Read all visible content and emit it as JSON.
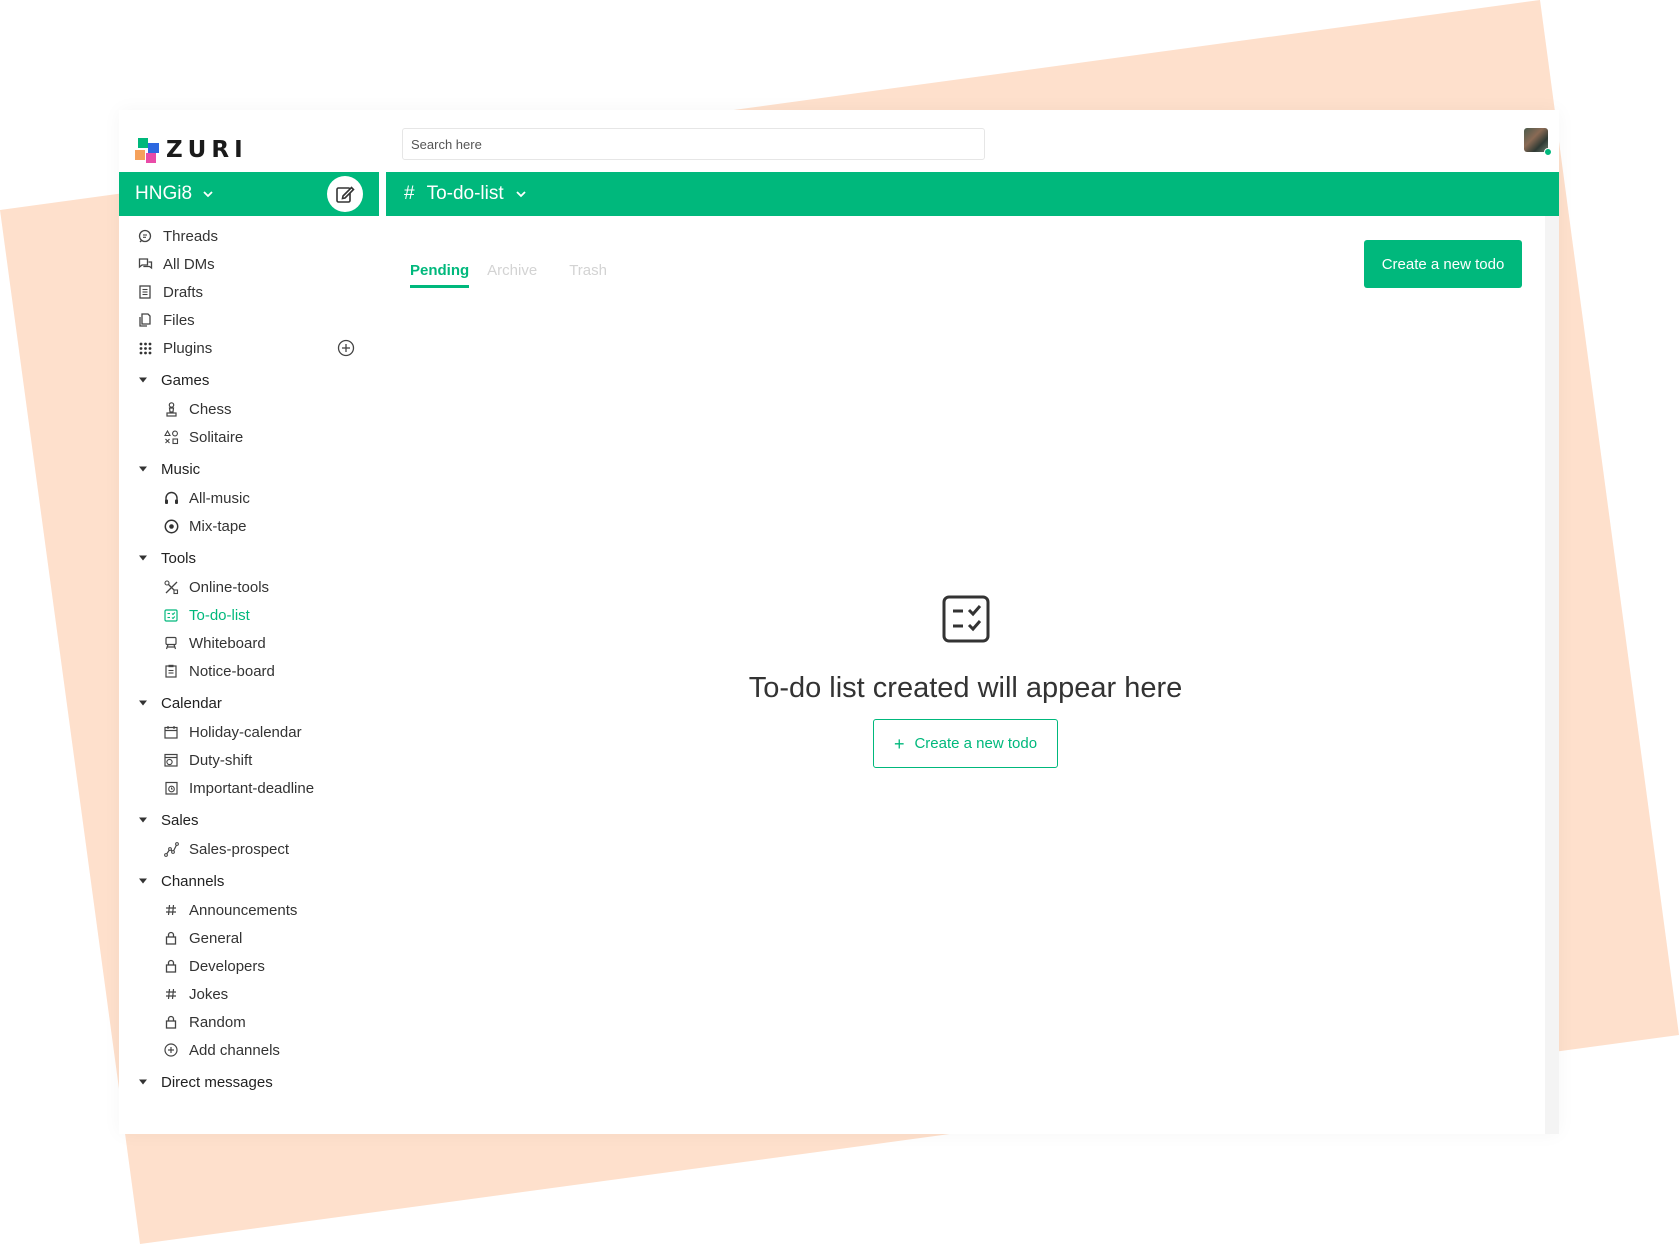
{
  "colors": {
    "brand": "#00b87c",
    "backdrop": "#fee0cc",
    "text": "#333333",
    "muted_tab": "#d3d3d3"
  },
  "logo": {
    "text": "ZURI"
  },
  "workspace": {
    "name": "HNGi8",
    "compose_icon": "edit-square-icon"
  },
  "sidebar": {
    "items": [
      {
        "label": "Threads",
        "icon": "chat-bubble-icon"
      },
      {
        "label": "All DMs",
        "icon": "messages-icon"
      },
      {
        "label": "Drafts",
        "icon": "document-icon"
      },
      {
        "label": "Files",
        "icon": "files-icon"
      },
      {
        "label": "Plugins",
        "icon": "grid-dots-icon"
      }
    ],
    "sections": [
      {
        "title": "Games",
        "items": [
          {
            "label": "Chess",
            "icon": "chess-pawn-icon"
          },
          {
            "label": "Solitaire",
            "icon": "shapes-icon"
          }
        ]
      },
      {
        "title": "Music",
        "items": [
          {
            "label": "All-music",
            "icon": "headphones-icon"
          },
          {
            "label": "Mix-tape",
            "icon": "disc-icon"
          }
        ]
      },
      {
        "title": "Tools",
        "items": [
          {
            "label": "Online-tools",
            "icon": "tools-icon"
          },
          {
            "label": "To-do-list",
            "icon": "checklist-icon"
          },
          {
            "label": "Whiteboard",
            "icon": "easel-icon"
          },
          {
            "label": "Notice-board",
            "icon": "clipboard-icon"
          }
        ]
      },
      {
        "title": "Calendar",
        "items": [
          {
            "label": "Holiday-calendar",
            "icon": "calendar-icon"
          },
          {
            "label": "Duty-shift",
            "icon": "calendar-clock-icon"
          },
          {
            "label": "Important-deadline",
            "icon": "deadline-icon"
          }
        ]
      },
      {
        "title": "Sales",
        "items": [
          {
            "label": "Sales-prospect",
            "icon": "chart-line-icon"
          }
        ]
      },
      {
        "title": "Channels",
        "items": [
          {
            "label": "Announcements",
            "icon": "hash-icon"
          },
          {
            "label": "General",
            "icon": "lock-icon"
          },
          {
            "label": "Developers",
            "icon": "lock-icon"
          },
          {
            "label": "Jokes",
            "icon": "hash-icon"
          },
          {
            "label": "Random",
            "icon": "lock-icon"
          },
          {
            "label": "Add channels",
            "icon": "plus-circle-icon"
          }
        ]
      },
      {
        "title": "Direct messages",
        "items": []
      }
    ]
  },
  "header": {
    "search_placeholder": "Search here"
  },
  "channel": {
    "name": "To-do-list"
  },
  "tabs": [
    {
      "label": "Pending"
    },
    {
      "label": "Archive"
    },
    {
      "label": "Trash"
    }
  ],
  "actions": {
    "create_label": "Create a new todo"
  },
  "empty_state": {
    "message": "To-do list created will appear here",
    "button_label": "Create a new todo",
    "icon": "checklist-icon"
  }
}
